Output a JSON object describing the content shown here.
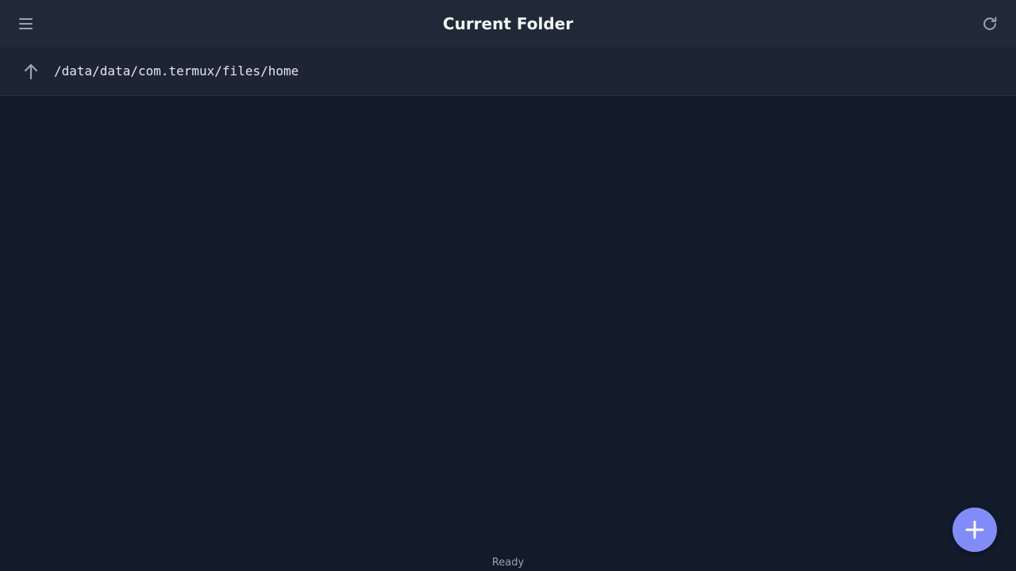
{
  "header": {
    "title": "Current Folder",
    "menu_icon": "hamburger-menu-icon",
    "refresh_icon": "refresh-icon"
  },
  "path_bar": {
    "up_icon": "arrow-up-icon",
    "current_path": "/data/data/com.termux/files/home"
  },
  "status_bar": {
    "text": "Ready"
  },
  "fab": {
    "icon": "plus-icon",
    "color": "#818cf8"
  },
  "colors": {
    "background": "#131a29",
    "header_bg": "#1f2937",
    "accent": "#818cf8"
  }
}
